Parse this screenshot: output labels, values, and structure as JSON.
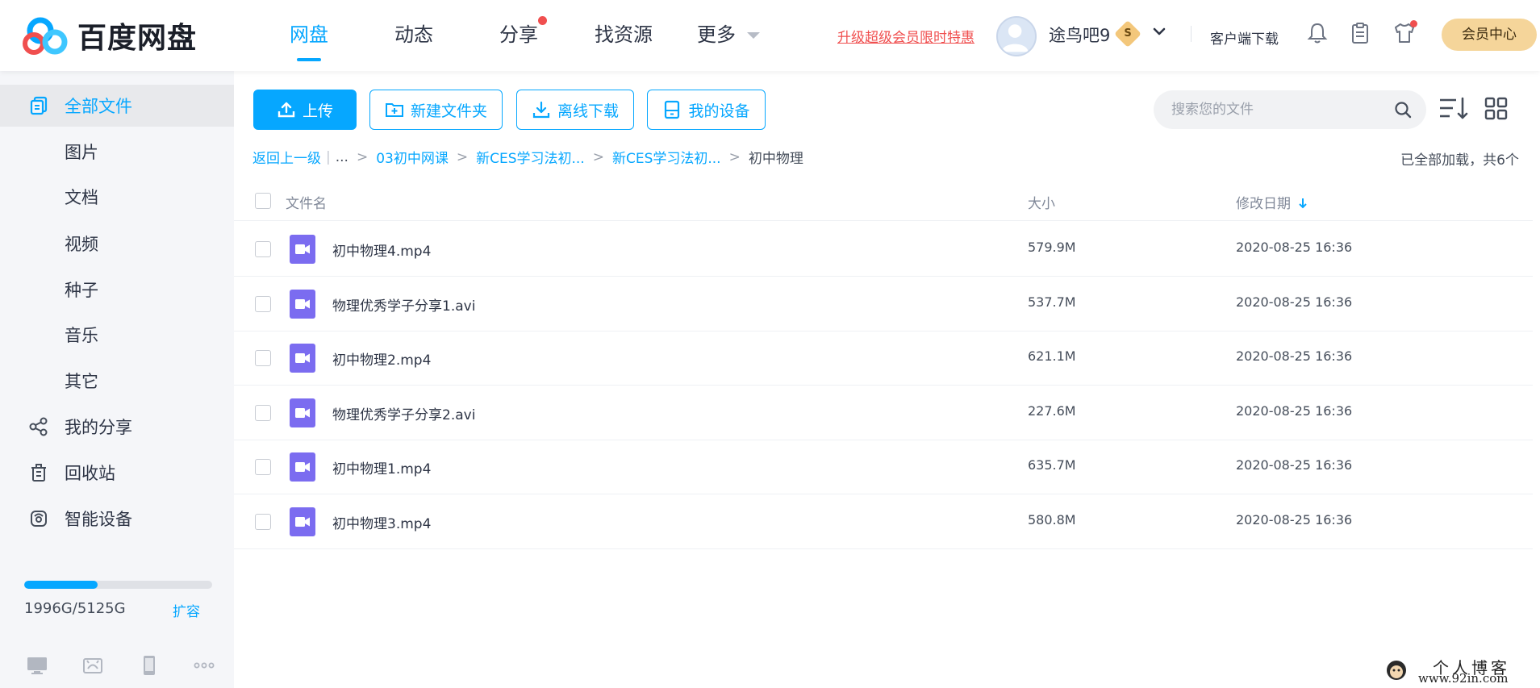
{
  "header": {
    "logo_text": "百度网盘",
    "nav": [
      {
        "label": "网盘",
        "active": true
      },
      {
        "label": "动态"
      },
      {
        "label": "分享",
        "dot": true
      },
      {
        "label": "找资源"
      },
      {
        "label": "更多",
        "caret": true
      }
    ],
    "promo": "升级超级会员限时特惠",
    "username": "途鸟吧9",
    "vip_badge": "S",
    "client_download": "客户端下载",
    "vip_center": "会员中心",
    "icons": [
      "bell-icon",
      "clipboard-icon",
      "tshirt-icon"
    ]
  },
  "sidebar": {
    "items": [
      {
        "label": "全部文件",
        "icon": "files-icon",
        "active": true
      },
      {
        "label": "图片"
      },
      {
        "label": "文档"
      },
      {
        "label": "视频"
      },
      {
        "label": "种子"
      },
      {
        "label": "音乐"
      },
      {
        "label": "其它"
      },
      {
        "label": "我的分享",
        "icon": "share-icon"
      },
      {
        "label": "回收站",
        "icon": "trash-icon"
      },
      {
        "label": "智能设备",
        "icon": "device-icon"
      }
    ],
    "quota": {
      "text": "1996G/5125G",
      "used_fraction": 0.389
    },
    "expand": "扩容",
    "device_icons": [
      "desktop-icon",
      "android-icon",
      "phone-icon",
      "more-icon"
    ]
  },
  "toolbar": {
    "upload": "上传",
    "new_folder": "新建文件夹",
    "offline_download": "离线下载",
    "my_devices": "我的设备",
    "search_placeholder": "搜索您的文件"
  },
  "breadcrumb": {
    "back": "返回上一级",
    "ellipsis": "...",
    "items": [
      "03初中网课",
      "新CES学习法初...",
      "新CES学习法初..."
    ],
    "current": "初中物理",
    "loaded": "已全部加载，共6个"
  },
  "table": {
    "headers": {
      "name": "文件名",
      "size": "大小",
      "modified": "修改日期"
    },
    "rows": [
      {
        "name": "初中物理4.mp4",
        "size": "579.9M",
        "date": "2020-08-25 16:36"
      },
      {
        "name": "物理优秀学子分享1.avi",
        "size": "537.7M",
        "date": "2020-08-25 16:36"
      },
      {
        "name": "初中物理2.mp4",
        "size": "621.1M",
        "date": "2020-08-25 16:36"
      },
      {
        "name": "物理优秀学子分享2.avi",
        "size": "227.6M",
        "date": "2020-08-25 16:36"
      },
      {
        "name": "初中物理1.mp4",
        "size": "635.7M",
        "date": "2020-08-25 16:36"
      },
      {
        "name": "初中物理3.mp4",
        "size": "580.8M",
        "date": "2020-08-25 16:36"
      }
    ]
  },
  "watermark": {
    "title": "个人博客",
    "url": "www.92in.com"
  },
  "colors": {
    "accent": "#06a7ff",
    "alert": "#f04f4f",
    "file_icon": "#7b6cf0",
    "vip": "#f5d59a"
  }
}
